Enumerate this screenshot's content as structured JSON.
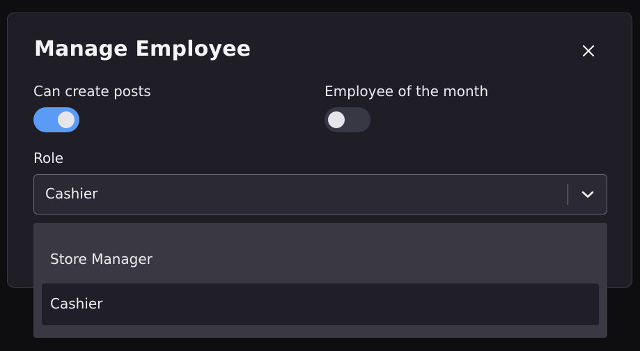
{
  "dialog": {
    "title": "Manage Employee",
    "close_icon": "close-icon"
  },
  "toggles": [
    {
      "label": "Can create posts",
      "state": "on"
    },
    {
      "label": "Employee of the month",
      "state": "off"
    }
  ],
  "role": {
    "label": "Role",
    "value": "Cashier",
    "chevron_icon": "chevron-down-icon",
    "options": [
      {
        "label": "Store Manager",
        "selected": false
      },
      {
        "label": "Cashier",
        "selected": true
      }
    ]
  },
  "colors": {
    "accent": "#5a9cf5",
    "dialog_bg": "#1f1e27",
    "menu_bg": "#393843",
    "selected_bg": "#201f29"
  }
}
